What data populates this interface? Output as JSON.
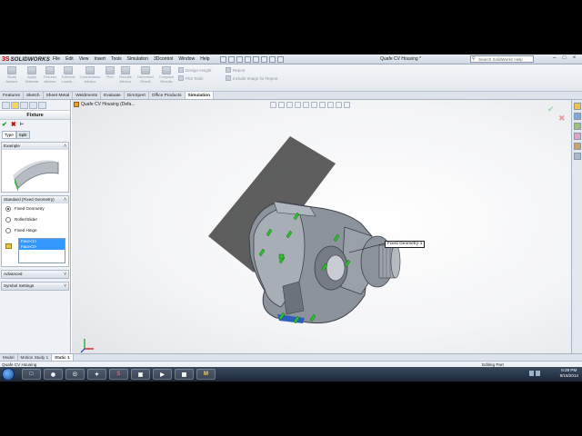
{
  "app": {
    "brand_ds": "3S",
    "brand": "SOLIDWORKS"
  },
  "menu": [
    "File",
    "Edit",
    "View",
    "Insert",
    "Tools",
    "Simulation",
    "3Dcontrol",
    "Window",
    "Help"
  ],
  "document_title": "Quafe CV Housing *",
  "search": {
    "placeholder": "Search SolidWorks Help"
  },
  "commands": [
    {
      "label": "Study Advisor"
    },
    {
      "label": "Apply Material"
    },
    {
      "label": "Fixtures Advisor"
    },
    {
      "label": "External Loads..."
    },
    {
      "label": "Connections Advisor"
    },
    {
      "label": "Run"
    },
    {
      "label": "Results Advisor"
    },
    {
      "label": "Deformed Result"
    },
    {
      "label": "Compare Results"
    }
  ],
  "commands_right": {
    "design_insight": "Design Insight",
    "plot_tools": "Plot Tools",
    "report": "Report",
    "include_image": "Include Image for Report"
  },
  "tabs": [
    "Features",
    "Sketch",
    "Sheet Metal",
    "Weldments",
    "Evaluate",
    "DimXpert",
    "Office Products",
    "Simulation"
  ],
  "active_tab": "Simulation",
  "panel": {
    "title": "Fixture",
    "subtabs": [
      "Type",
      "Split"
    ],
    "example_header": "Example",
    "standard_header": "Standard (Fixed Geometry)",
    "options": [
      "Fixed Geometry",
      "Roller/Slider",
      "Fixed Hinge"
    ],
    "selected_option": "Fixed Geometry",
    "faces": [
      "Face<1>",
      "Face<2>"
    ],
    "advanced_header": "Advanced",
    "symbol_header": "Symbol Settings"
  },
  "viewport": {
    "tree_label": "Quafe CV Housing (Defa...",
    "callout": "Fixed Geometry-1"
  },
  "bottom_tabs": [
    "Model",
    "Motion Study 1",
    "Static 1"
  ],
  "active_bottom_tab": "Static 1",
  "status": {
    "left": "Quafe CV Housing",
    "right": "Editing Part"
  },
  "tray": {
    "time": "6:39 PM",
    "date": "9/15/2014"
  },
  "colors": {
    "accent_red": "#c00000",
    "ok_green": "#1a9a1a",
    "fixture_green": "#2dbf2d"
  }
}
